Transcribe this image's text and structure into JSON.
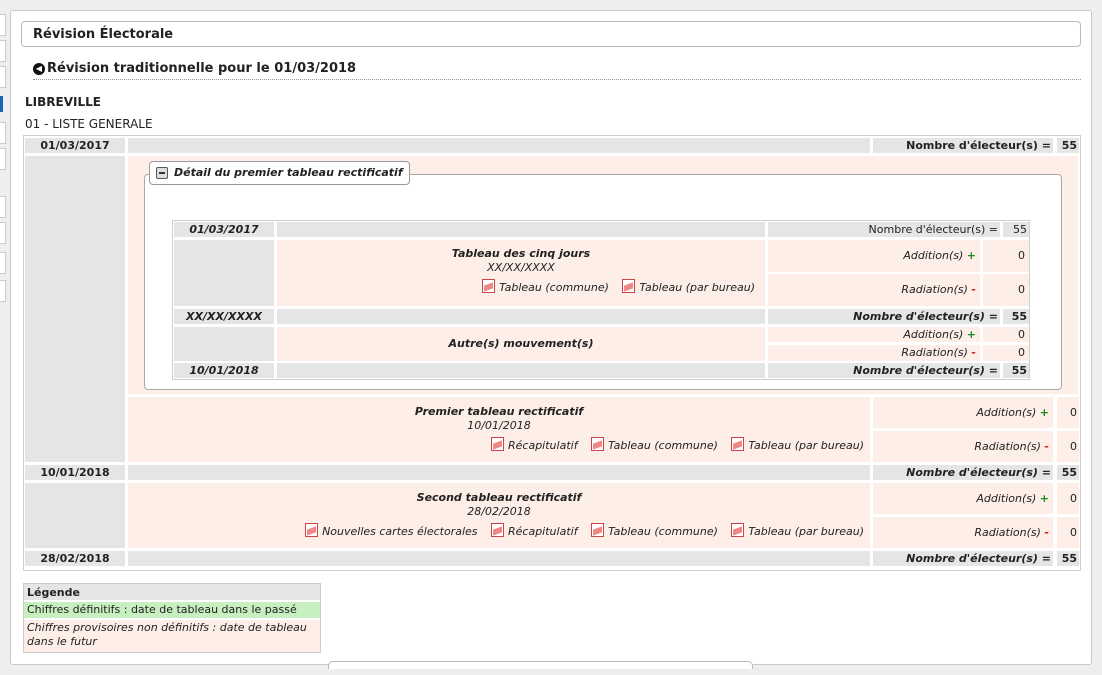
{
  "page": {
    "title": "Révision Électorale",
    "back_label": "Révision traditionnelle pour le 01/03/2018",
    "commune": "LIBREVILLE",
    "liste": "01 - LISTE GENERALE"
  },
  "labels": {
    "nombre_electeurs": "Nombre d'électeur(s) =",
    "additions": "Addition(s)",
    "radiations": "Radiation(s)",
    "plus": "+",
    "minus": "-"
  },
  "detail": {
    "legend": "Détail du premier tableau rectificatif",
    "row1_date": "01/03/2017",
    "row1_count": "55",
    "cinq_jours_title": "Tableau des cinq jours",
    "cinq_jours_date": "XX/XX/XXXX",
    "cinq_jours_add": "0",
    "cinq_jours_rad": "0",
    "link_commune": "Tableau (commune)",
    "link_bureau": "Tableau (par bureau)",
    "row2_date": "XX/XX/XXXX",
    "row2_count": "55",
    "autres_title": "Autre(s) mouvement(s)",
    "autres_add": "0",
    "autres_rad": "0",
    "row3_date": "10/01/2018",
    "row3_count": "55"
  },
  "main": {
    "row1_date": "01/03/2017",
    "row1_count": "55",
    "premier_title": "Premier tableau rectificatif",
    "premier_date": "10/01/2018",
    "premier_add": "0",
    "premier_rad": "0",
    "link_recap": "Récapitulatif",
    "link_commune": "Tableau (commune)",
    "link_bureau": "Tableau (par bureau)",
    "row2_date": "10/01/2018",
    "row2_count": "55",
    "second_title": "Second tableau rectificatif",
    "second_date": "28/02/2018",
    "second_add": "0",
    "second_rad": "0",
    "link_cartes": "Nouvelles cartes électorales",
    "row3_date": "28/02/2018",
    "row3_count": "55"
  },
  "legend": {
    "title": "Légende",
    "definitive": "Chiffres définitifs : date de tableau dans le passé",
    "provisional": "Chiffres provisoires non définitifs : date de tableau dans le futur"
  },
  "colors": {
    "definitive_bg": "#c8efc0",
    "provisional_bg": "#fdeee8",
    "header_bg": "#e5e5e5"
  }
}
